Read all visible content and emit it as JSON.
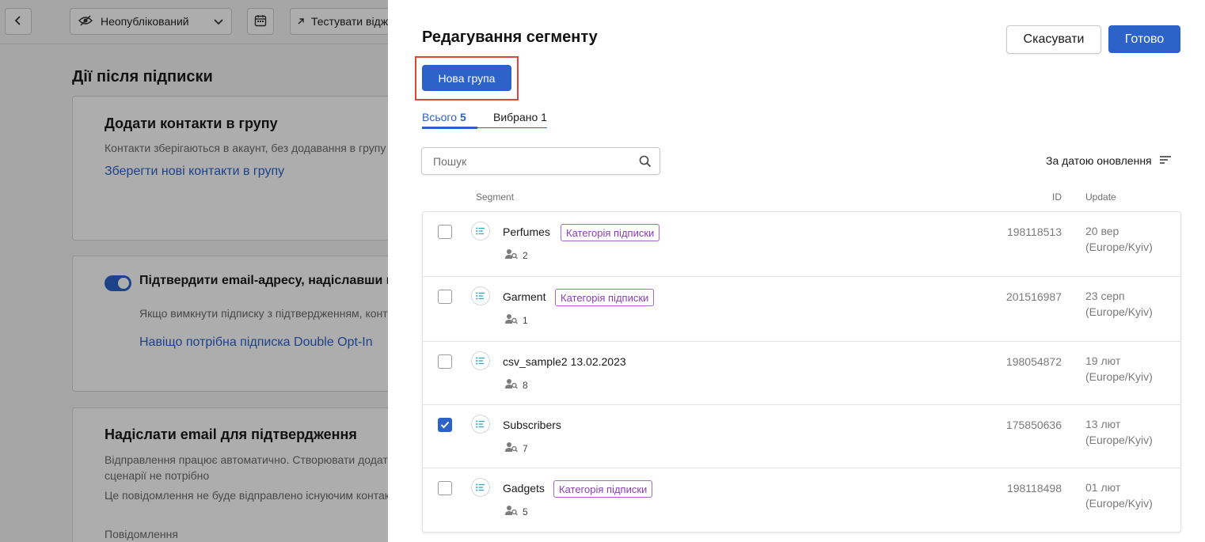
{
  "topbar": {
    "status_label": "Неопублікований",
    "test_label": "Тестувати віджет"
  },
  "background": {
    "section_title": "Дії після підписки",
    "card1": {
      "title": "Додати контакти в групу",
      "desc": "Контакти зберігаються в акаунт, без додавання в групу",
      "link": "Зберегти нові контакти в групу"
    },
    "card2": {
      "title": "Підтвердити email-адресу, надіславши повідомлення",
      "desc": "Якщо вимкнути підписку з підтвердженням, контакти",
      "link": "Навіщо потрібна підписка Double Opt-In"
    },
    "card3": {
      "title": "Надіслати email для підтвердження",
      "desc_line1": "Відправлення працює автоматично. Створювати додаткові",
      "desc_line2": "сценарії не потрібно",
      "desc_line3": "Це повідомлення не буде відправлено існуючим контактам",
      "label": "Повідомлення"
    }
  },
  "panel": {
    "title": "Редагування сегменту",
    "cancel_label": "Скасувати",
    "done_label": "Готово",
    "new_group_label": "Нова група",
    "tabs": {
      "all_label": "Всього",
      "all_count": "5",
      "selected_label": "Вибрано 1"
    },
    "search": {
      "placeholder": "Пошук",
      "value": ""
    },
    "sort_label": "За датою оновлення",
    "columns": {
      "segment": "Segment",
      "id": "ID",
      "update": "Update"
    }
  },
  "rows": [
    {
      "name": "Perfumes",
      "badge": "Категорія підписки",
      "count": "2",
      "id": "198118513",
      "date": "20 вер",
      "tz": "(Europe/Kyiv)",
      "checked": false
    },
    {
      "name": "Garment",
      "badge": "Категорія підписки",
      "count": "1",
      "id": "201516987",
      "date": "23 серп",
      "tz": "(Europe/Kyiv)",
      "checked": false
    },
    {
      "name": "csv_sample2 13.02.2023",
      "badge": "",
      "count": "8",
      "id": "198054872",
      "date": "19 лют",
      "tz": "(Europe/Kyiv)",
      "checked": false
    },
    {
      "name": "Subscribers",
      "badge": "",
      "count": "7",
      "id": "175850636",
      "date": "13 лют",
      "tz": "(Europe/Kyiv)",
      "checked": true
    },
    {
      "name": "Gadgets",
      "badge": "Категорія підписки",
      "count": "5",
      "id": "198118498",
      "date": "01 лют",
      "tz": "(Europe/Kyiv)",
      "checked": false
    }
  ],
  "colors": {
    "accent": "#2d62c8",
    "badge": "#8a3fb5",
    "highlight": "#e0453a"
  }
}
